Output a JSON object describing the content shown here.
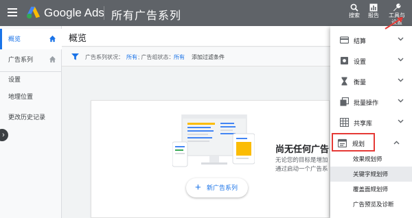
{
  "header": {
    "brand": "Google Ads",
    "campaign_title": "所有广告系列",
    "actions": [
      {
        "label": "搜索",
        "icon": "search-icon"
      },
      {
        "label": "报告",
        "icon": "bar-chart-icon"
      },
      {
        "label": "工具与设置",
        "icon": "wrench-icon"
      }
    ],
    "tools_label_line1": "工具与",
    "tools_label_line2": "设置"
  },
  "sidebar": {
    "items": [
      {
        "label": "概览",
        "active": true
      },
      {
        "label": "广告系列",
        "active": false
      },
      {
        "label": "设置",
        "active": false
      },
      {
        "label": "地理位置",
        "active": false
      },
      {
        "label": "更改历史记录",
        "active": false
      }
    ]
  },
  "main": {
    "title": "概览",
    "filters": {
      "campaign_status_label": "广告系列状况：",
      "campaign_status_value": "所有",
      "adgroup_status_label": "; 广告组状态：",
      "adgroup_status_value": "所有",
      "add_filter": "添加过滤条件"
    },
    "empty_state": {
      "title": "尚无任何广告系",
      "desc_line1": "无论您的目标是增加",
      "desc_line2": "通过启动一个广告系",
      "button": "新广告系列"
    }
  },
  "tools_menu": {
    "items": [
      {
        "label": "结算",
        "icon": "credit-card-icon"
      },
      {
        "label": "设置",
        "icon": "settings-icon"
      },
      {
        "label": "衡量",
        "icon": "hourglass-icon"
      },
      {
        "label": "批量操作",
        "icon": "copy-icon"
      },
      {
        "label": "共享库",
        "icon": "grid-icon"
      },
      {
        "label": "规划",
        "icon": "calendar-icon"
      }
    ],
    "planning_sub": [
      "效果规划师",
      "关键字规划师",
      "覆盖面规划师",
      "广告预览及诊断"
    ]
  },
  "colors": {
    "topbar": "#5f6368",
    "accent": "#1a73e8",
    "highlight": "#e53935"
  }
}
